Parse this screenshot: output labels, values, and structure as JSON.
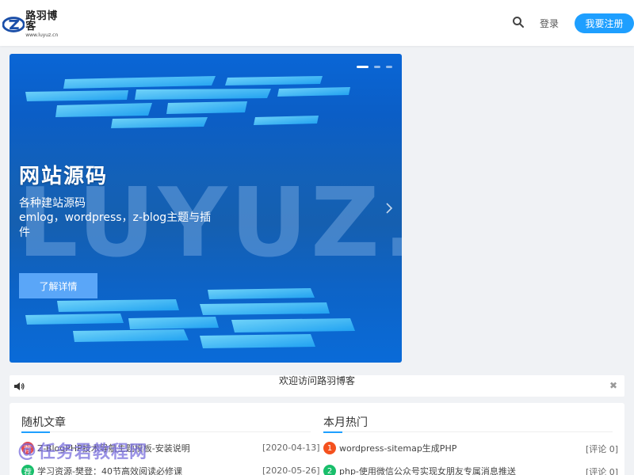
{
  "header": {
    "logo_title": "路羽博客",
    "logo_url": "www.luyuz.cn",
    "login_label": "登录",
    "register_label": "我要注册"
  },
  "banner": {
    "title": "网站源码",
    "subtitle": "各种建站源码",
    "description": "emlog，wordpress，z-blog主题与插件",
    "cta_label": "了解详情",
    "watermark_text": "LUYUZ.CN",
    "slides": 3,
    "active_slide": 1
  },
  "notice": {
    "text": "欢迎访问路羽博客"
  },
  "random_posts": {
    "title": "随机文章",
    "items": [
      {
        "badge": "荐",
        "badge_color": "#e5484d",
        "text": "Z-BlogPHP技术导航主题模板-安装说明",
        "date": "[2020-04-13]"
      },
      {
        "badge": "荐",
        "badge_color": "#19be6b",
        "text": "学习资源-樊登：40节高效阅读必修课",
        "date": "[2020-05-26]"
      }
    ]
  },
  "hot_posts": {
    "title": "本月热门",
    "items": [
      {
        "badge": "1",
        "badge_color": "#f4511e",
        "text": "wordpress-sitemap生成PHP",
        "meta": "[评论 0]"
      },
      {
        "badge": "2",
        "badge_color": "#19be6b",
        "text": "php-使用微信公众号实现女朋友专属消息推送",
        "meta": "[评论 0]"
      }
    ]
  },
  "watermark": {
    "text": "任务君教程网"
  },
  "colors": {
    "accent": "#1e9fff",
    "banner_bg": "#0b5ec6"
  }
}
